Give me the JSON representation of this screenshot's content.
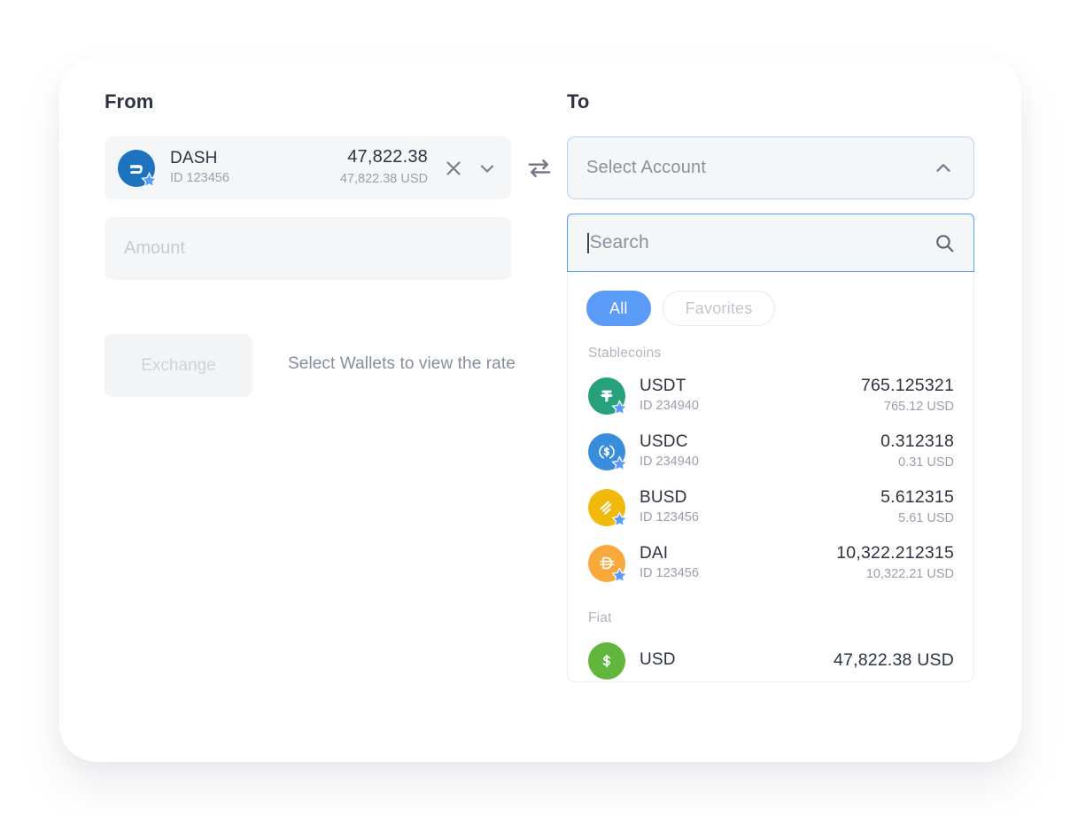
{
  "from": {
    "label": "From",
    "wallet": {
      "symbol": "DASH",
      "id": "ID 123456",
      "amount": "47,822.38",
      "amount_usd": "47,822.38 USD",
      "icon": "dash-coin-icon",
      "icon_color": "#1e73be",
      "favorite": true
    },
    "clear_icon": "close-icon",
    "expand_icon": "chevron-down-icon",
    "amount_placeholder": "Amount",
    "amount_value": ""
  },
  "swap": {
    "icon": "swap-arrows-icon"
  },
  "to": {
    "label": "To",
    "select_placeholder": "Select Account",
    "collapse_icon": "chevron-up-icon",
    "search": {
      "placeholder": "Search",
      "value": "",
      "icon": "search-icon"
    },
    "filters": [
      {
        "label": "All",
        "active": true
      },
      {
        "label": "Favorites",
        "active": false
      }
    ],
    "groups": [
      {
        "label": "Stablecoins",
        "items": [
          {
            "symbol": "USDT",
            "id": "ID 234940",
            "amount": "765.125321",
            "amount_usd": "765.12 USD",
            "icon": "usdt-coin-icon",
            "icon_color": "#26a17b",
            "favorite": true
          },
          {
            "symbol": "USDC",
            "id": "ID 234940",
            "amount": "0.312318",
            "amount_usd": "0.31 USD",
            "icon": "usdc-coin-icon",
            "icon_color": "#3a8ddd",
            "favorite": true
          },
          {
            "symbol": "BUSD",
            "id": "ID 123456",
            "amount": "5.612315",
            "amount_usd": "5.61 USD",
            "icon": "busd-coin-icon",
            "icon_color": "#f0b90b",
            "favorite": true
          },
          {
            "symbol": "DAI",
            "id": "ID 123456",
            "amount": "10,322.212315",
            "amount_usd": "10,322.21 USD",
            "icon": "dai-coin-icon",
            "icon_color": "#f7a93b",
            "favorite": true
          }
        ]
      },
      {
        "label": "Fiat",
        "items": [
          {
            "symbol": "USD",
            "id": "",
            "amount": "47,822.38 USD",
            "amount_usd": "",
            "icon": "usd-fiat-icon",
            "icon_color": "#62b63c",
            "favorite": false
          }
        ]
      }
    ]
  },
  "actions": {
    "exchange_label": "Exchange",
    "rate_hint": "Select Wallets to view the rate"
  },
  "colors": {
    "accent": "#5b9bf8",
    "text_primary": "#2d3340",
    "text_muted": "#9aa0ab",
    "field_bg": "#f5f6f8"
  }
}
